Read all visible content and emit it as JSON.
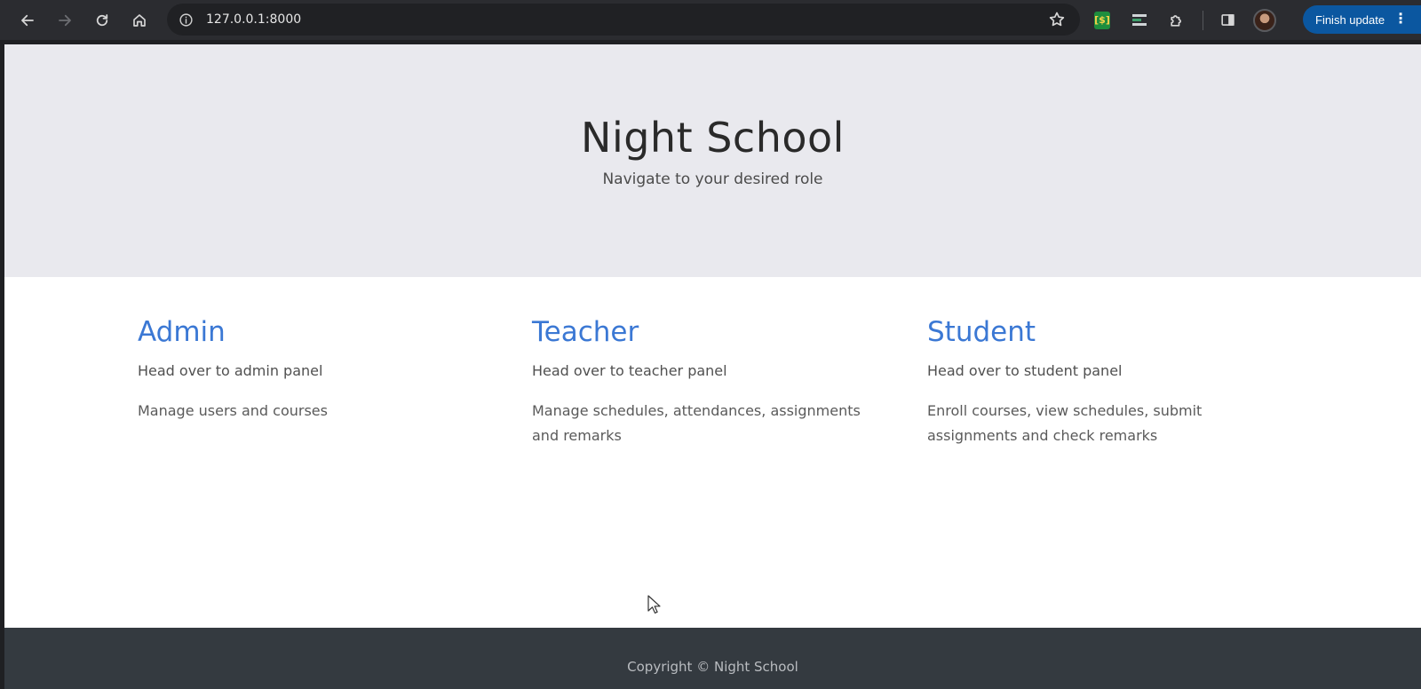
{
  "browser": {
    "url": "127.0.0.1:8000",
    "update_label": "Finish update",
    "update_menu_glyph": "⋮",
    "sheets_ext_glyph": "[$]"
  },
  "hero": {
    "title": "Night School",
    "subtitle": "Navigate to your desired role"
  },
  "roles": [
    {
      "title": "Admin",
      "link": "Head over to admin panel",
      "description": "Manage users and courses"
    },
    {
      "title": "Teacher",
      "link": "Head over to teacher panel",
      "description": "Manage schedules, attendances, assignments and remarks"
    },
    {
      "title": "Student",
      "link": "Head over to student panel",
      "description": "Enroll courses, view schedules, submit assignments and check remarks"
    }
  ],
  "footer": {
    "copyright": "Copyright © Night School"
  },
  "colors": {
    "accent_link": "#3b78d4",
    "hero_bg": "#e9e9ee",
    "footer_bg": "#343a40",
    "update_button": "#0b57a0"
  },
  "icons": {
    "back": "arrow-left-icon",
    "forward": "arrow-right-icon",
    "reload": "reload-icon",
    "home": "home-icon",
    "site_info": "info-icon",
    "bookmark": "star-icon",
    "extensions": "puzzle-icon",
    "side_panel": "side-panel-icon"
  }
}
